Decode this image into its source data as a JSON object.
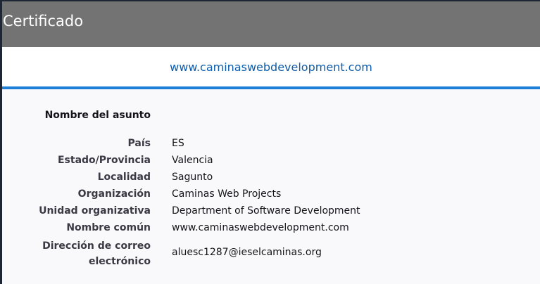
{
  "window": {
    "title": "Certificado"
  },
  "tab": {
    "label": "www.caminaswebdevelopment.com"
  },
  "subject": {
    "heading": "Nombre del asunto",
    "fields": [
      {
        "label": "País",
        "value": "ES"
      },
      {
        "label": "Estado/Provincia",
        "value": "Valencia"
      },
      {
        "label": "Localidad",
        "value": "Sagunto"
      },
      {
        "label": "Organización",
        "value": "Caminas Web Projects"
      },
      {
        "label": "Unidad organizativa",
        "value": "Department of Software Development"
      },
      {
        "label": "Nombre común",
        "value": "www.caminaswebdevelopment.com"
      },
      {
        "label": "Dirección de correo electrónico",
        "value": "aluesc1287@ieselcaminas.org"
      }
    ]
  },
  "colors": {
    "titlebar": "#737373",
    "accent": "#1c7ed6",
    "link": "#0b5cad",
    "background": "#f9f9fb"
  }
}
